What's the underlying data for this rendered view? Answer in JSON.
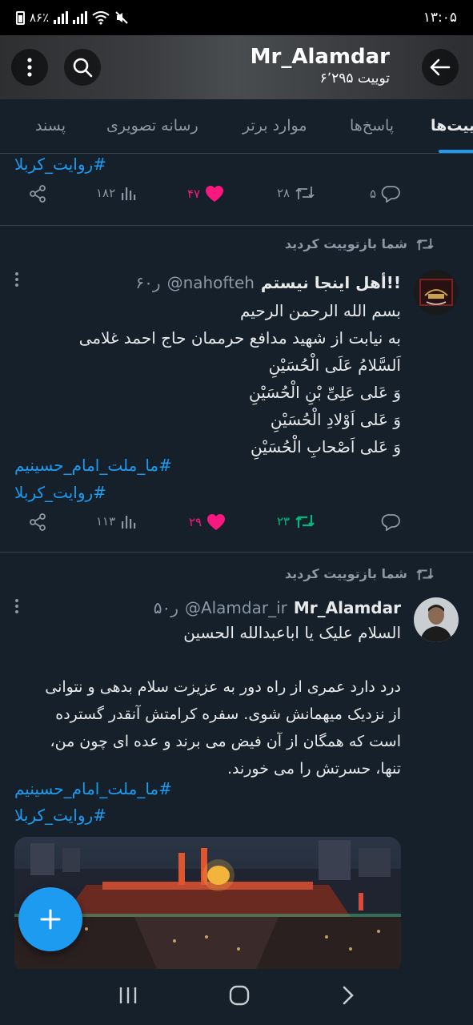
{
  "status_bar": {
    "battery": "۸۶٪",
    "time": "۱۳:۰۵"
  },
  "header": {
    "title": "Mr_Alamdar",
    "tweet_count": "۶٬۲۹۵ توییت"
  },
  "tabs": [
    {
      "label": "توییت‌ها",
      "active": true
    },
    {
      "label": "پاسخ‌ها",
      "active": false
    },
    {
      "label": "موارد برتر",
      "active": false
    },
    {
      "label": "رسانه تصویری",
      "active": false
    },
    {
      "label": "پسند",
      "active": false
    }
  ],
  "tweet0": {
    "hashtag": "#روایت_کربلا",
    "replies": "۵",
    "retweets": "۲۸",
    "likes": "۴۷",
    "views": "۱۸۲"
  },
  "tweet1": {
    "retweet_label": "شما بازتوییت کردید",
    "display_name": "أهل اینجا نیستم!!",
    "handle": "@nahofteh",
    "time": "۶۰ر",
    "lines": [
      "بسم الله الرحمن الرحیم",
      "به نیابت از شهید مدافع حرممان حاج احمد غلامی",
      "اَلسَّلامُ عَلَی الْحُسَیْنِ",
      "وَ عَلی عَلِیِّ بْنِ الْحُسَیْنِ",
      "وَ عَلی اَوْلادِ الْحُسَیْنِ",
      "وَ عَلی اَصْحابِ الْحُسَیْنِ"
    ],
    "hashtags": [
      "#ما_ملت_امام_حسینیم",
      "#روایت_کربلا"
    ],
    "replies": "",
    "retweets": "۲۳",
    "likes": "۲۹",
    "views": "۱۱۳"
  },
  "tweet2": {
    "retweet_label": "شما بازتوییت کردید",
    "display_name": "Mr_Alamdar",
    "handle": "@Alamdar_ir",
    "time": "۵۰ر",
    "line1": "السلام علیک یا اباعبدالله الحسین",
    "paragraph": [
      "درد دارد عمری از راه دور به عزیزت سلام بدهی و نتوانی",
      "از نزدیک میهمانش شوی. سفره کرامتش آنقدر گسترده",
      "است که همگان از آن فیض می برند و عده ای چون من،",
      "تنها، حسرتش را می خورند."
    ],
    "hashtags": [
      "#ما_ملت_امام_حسینیم",
      "#روایت_کربلا"
    ]
  },
  "colors": {
    "background": "#15202b",
    "accent": "#1d9bf0",
    "like": "#f91880",
    "retweet": "#00ba7c",
    "muted": "#8b98a5"
  }
}
